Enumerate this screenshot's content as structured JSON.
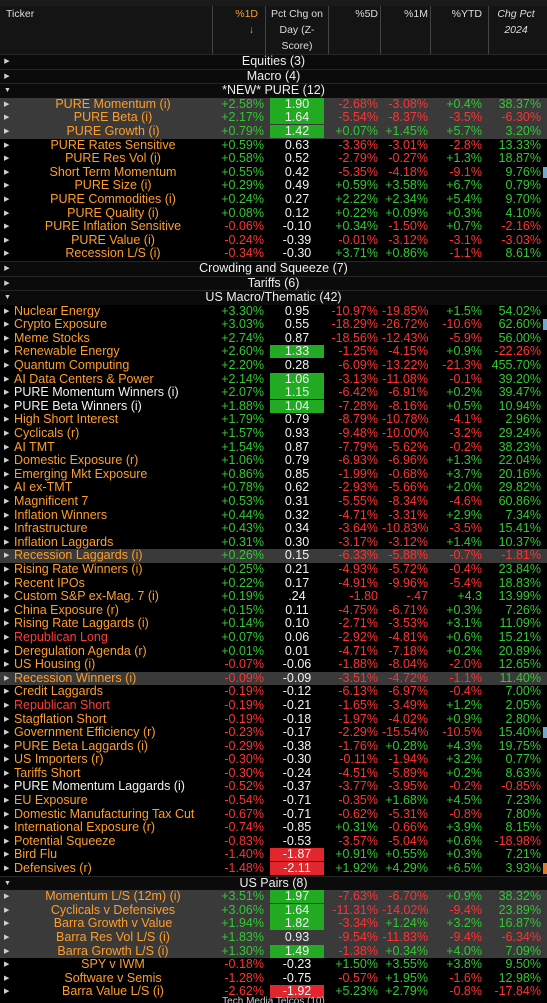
{
  "header": {
    "ticker": "Ticker",
    "pct_1d": "%1D",
    "z_score": "Pct Chg on Day (Z-Score)",
    "pct_5d": "%5D",
    "pct_1m": "%1M",
    "pct_ytd": "%YTD",
    "chg_2024": "Chg Pct 2024",
    "sort_icon": "arrow-down"
  },
  "colors": {
    "positive": "#32c832",
    "negative": "#ff3333",
    "z_positive_bg": "#22aa22",
    "z_negative_bg": "#e2262e",
    "orange": "#ff9d2a",
    "selected_row": "#3a3a3a"
  },
  "rows": [
    {
      "type": "group",
      "label": "Equities (3)",
      "expanded": false
    },
    {
      "type": "group",
      "label": "Macro (4)",
      "expanded": false
    },
    {
      "type": "group",
      "label": "*NEW* PURE (12)",
      "expanded": true
    },
    {
      "type": "row",
      "name": "PURE Momentum (i)",
      "style": "orange-center",
      "sel": true,
      "d1": "+2.58%",
      "z": "1.90",
      "zbg": "pos",
      "d5": "-2.68%",
      "m1": "-3.08%",
      "ytd": "+0.4%",
      "c24": "38.37%"
    },
    {
      "type": "row",
      "name": "PURE Beta (i)",
      "style": "orange-center",
      "sel": true,
      "d1": "+2.17%",
      "z": "1.64",
      "zbg": "pos",
      "d5": "-5.54%",
      "m1": "-8.37%",
      "ytd": "-3.5%",
      "c24": "-6.30%"
    },
    {
      "type": "row",
      "name": "PURE Growth (i)",
      "style": "orange-center",
      "sel": true,
      "d1": "+0.79%",
      "z": "1.42",
      "zbg": "pos",
      "d5": "+0.07%",
      "m1": "+1.45%",
      "ytd": "+5.7%",
      "c24": "3.20%"
    },
    {
      "type": "row",
      "name": "PURE Rates Sensitive",
      "style": "orange-center",
      "d1": "+0.59%",
      "z": "0.63",
      "d5": "-3.36%",
      "m1": "-3.01%",
      "ytd": "-2.8%",
      "c24": "13.33%"
    },
    {
      "type": "row",
      "name": "PURE Res Vol (i)",
      "style": "orange-center",
      "d1": "+0.58%",
      "z": "0.52",
      "d5": "-2.79%",
      "m1": "-0.27%",
      "ytd": "+1.3%",
      "c24": "18.87%"
    },
    {
      "type": "row",
      "name": "Short Term Momentum",
      "style": "orange-center",
      "d1": "+0.55%",
      "z": "0.42",
      "d5": "-5.35%",
      "m1": "-4.18%",
      "ytd": "-9.1%",
      "c24": "9.76%",
      "mark": true
    },
    {
      "type": "row",
      "name": "PURE Size (i)",
      "style": "orange-center",
      "d1": "+0.29%",
      "z": "0.49",
      "d5": "+0.59%",
      "m1": "+3.58%",
      "ytd": "+6.7%",
      "c24": "0.79%"
    },
    {
      "type": "row",
      "name": "PURE Commodities (i)",
      "style": "orange-center",
      "d1": "+0.24%",
      "z": "0.27",
      "d5": "+2.22%",
      "m1": "+2.34%",
      "ytd": "+5.4%",
      "c24": "9.70%"
    },
    {
      "type": "row",
      "name": "PURE Quality (i)",
      "style": "orange-center",
      "d1": "+0.08%",
      "z": "0.12",
      "d5": "+0.22%",
      "m1": "+0.09%",
      "ytd": "+0.3%",
      "c24": "4.10%"
    },
    {
      "type": "row",
      "name": "PURE Inflation Sensitive",
      "style": "orange-center",
      "d1": "-0.06%",
      "z": "-0.10",
      "d5": "+0.34%",
      "m1": "-1.50%",
      "ytd": "+0.7%",
      "c24": "-2.16%"
    },
    {
      "type": "row",
      "name": "PURE Value (i)",
      "style": "orange-center",
      "d1": "-0.24%",
      "z": "-0.39",
      "d5": "-0.01%",
      "m1": "-3.12%",
      "ytd": "-3.1%",
      "c24": "-3.03%"
    },
    {
      "type": "row",
      "name": "Recession L/S (i)",
      "style": "orange-center",
      "d1": "-0.34%",
      "z": "-0.30",
      "d5": "+3.71%",
      "m1": "+0.86%",
      "ytd": "-1.1%",
      "c24": "8.61%"
    },
    {
      "type": "group",
      "label": "Crowding and Squeeze (7)",
      "expanded": false
    },
    {
      "type": "group",
      "label": "Tariffs (6)",
      "expanded": false
    },
    {
      "type": "group",
      "label": "US Macro/Thematic (42)",
      "expanded": true
    },
    {
      "type": "row",
      "name": "Nuclear Energy",
      "style": "orange",
      "d1": "+3.30%",
      "z": "0.95",
      "d5": "-10.97%",
      "m1": "-19.85%",
      "ytd": "+1.5%",
      "c24": "54.02%"
    },
    {
      "type": "row",
      "name": "Crypto Exposure",
      "style": "orange",
      "d1": "+3.03%",
      "z": "0.55",
      "d5": "-18.29%",
      "m1": "-26.72%",
      "ytd": "-10.6%",
      "c24": "62.60%",
      "mark": true
    },
    {
      "type": "row",
      "name": "Meme Stocks",
      "style": "orange",
      "d1": "+2.74%",
      "z": "0.87",
      "d5": "-18.56%",
      "m1": "-12.43%",
      "ytd": "-5.9%",
      "c24": "56.00%"
    },
    {
      "type": "row",
      "name": "Renewable Energy",
      "style": "orange",
      "d1": "+2.60%",
      "z": "1.33",
      "zbg": "pos",
      "d5": "-1.25%",
      "m1": "-4.15%",
      "ytd": "+0.9%",
      "c24": "-22.26%"
    },
    {
      "type": "row",
      "name": "Quantum Computing",
      "style": "orange",
      "d1": "+2.20%",
      "z": "0.28",
      "d5": "-6.09%",
      "m1": "-13.22%",
      "ytd": "-21.3%",
      "c24": "455.70%"
    },
    {
      "type": "row",
      "name": "AI Data Centers & Power",
      "style": "orange",
      "d1": "+2.14%",
      "z": "1.06",
      "zbg": "pos",
      "d5": "-3.13%",
      "m1": "-11.08%",
      "ytd": "-0.1%",
      "c24": "39.20%"
    },
    {
      "type": "row",
      "name": "PURE Momentum Winners (i)",
      "style": "white",
      "d1": "+2.07%",
      "z": "1.15",
      "zbg": "pos",
      "d5": "-6.42%",
      "m1": "-6.91%",
      "ytd": "+0.2%",
      "c24": "39.47%"
    },
    {
      "type": "row",
      "name": "PURE Beta Winners (i)",
      "style": "white",
      "d1": "+1.88%",
      "z": "1.04",
      "zbg": "pos",
      "d5": "-7.28%",
      "m1": "-8.16%",
      "ytd": "+0.5%",
      "c24": "10.94%"
    },
    {
      "type": "row",
      "name": "High Short Interest",
      "style": "orange",
      "d1": "+1.79%",
      "z": "0.79",
      "d5": "-8.79%",
      "m1": "-10.78%",
      "ytd": "-4.1%",
      "c24": "2.96%"
    },
    {
      "type": "row",
      "name": "Cyclicals (r)",
      "style": "orange",
      "d1": "+1.57%",
      "z": "0.93",
      "d5": "-9.48%",
      "m1": "-10.00%",
      "ytd": "-3.2%",
      "c24": "29.24%"
    },
    {
      "type": "row",
      "name": "AI TMT",
      "style": "orange",
      "d1": "+1.54%",
      "z": "0.87",
      "d5": "-7.79%",
      "m1": "-5.62%",
      "ytd": "-0.2%",
      "c24": "38.23%"
    },
    {
      "type": "row",
      "name": "Domestic Exposure (r)",
      "style": "orange",
      "d1": "+1.06%",
      "z": "0.79",
      "d5": "-6.93%",
      "m1": "-6.96%",
      "ytd": "+1.3%",
      "c24": "22.04%"
    },
    {
      "type": "row",
      "name": "Emerging Mkt Exposure",
      "style": "orange",
      "d1": "+0.86%",
      "z": "0.85",
      "d5": "-1.99%",
      "m1": "-0.68%",
      "ytd": "+3.7%",
      "c24": "20.16%"
    },
    {
      "type": "row",
      "name": "AI ex-TMT",
      "style": "orange",
      "d1": "+0.78%",
      "z": "0.62",
      "d5": "-2.93%",
      "m1": "-5.66%",
      "ytd": "+2.0%",
      "c24": "29.82%"
    },
    {
      "type": "row",
      "name": "Magnificent 7",
      "style": "orange",
      "d1": "+0.53%",
      "z": "0.31",
      "d5": "-5.55%",
      "m1": "-8.34%",
      "ytd": "-4.6%",
      "c24": "60.86%"
    },
    {
      "type": "row",
      "name": "Inflation Winners",
      "style": "orange",
      "d1": "+0.44%",
      "z": "0.32",
      "d5": "-4.71%",
      "m1": "-3.31%",
      "ytd": "+2.9%",
      "c24": "7.34%"
    },
    {
      "type": "row",
      "name": "Infrastructure",
      "style": "orange",
      "d1": "+0.43%",
      "z": "0.34",
      "d5": "-3.64%",
      "m1": "-10.83%",
      "ytd": "-3.5%",
      "c24": "15.41%"
    },
    {
      "type": "row",
      "name": "Inflation Laggards",
      "style": "orange",
      "d1": "+0.31%",
      "z": "0.30",
      "d5": "-3.17%",
      "m1": "-3.12%",
      "ytd": "+1.4%",
      "c24": "10.37%"
    },
    {
      "type": "row",
      "name": "Recession Laggards (i)",
      "style": "orange",
      "sel": true,
      "d1": "+0.26%",
      "z": "0.15",
      "d5": "-6.33%",
      "m1": "-5.88%",
      "ytd": "-0.7%",
      "c24": "-1.81%"
    },
    {
      "type": "row",
      "name": "Rising Rate Winners (i)",
      "style": "orange",
      "d1": "+0.25%",
      "z": "0.21",
      "d5": "-4.93%",
      "m1": "-5.72%",
      "ytd": "-0.4%",
      "c24": "23.84%"
    },
    {
      "type": "row",
      "name": "Recent IPOs",
      "style": "orange",
      "d1": "+0.22%",
      "z": "0.17",
      "d5": "-4.91%",
      "m1": "-9.96%",
      "ytd": "-5.4%",
      "c24": "18.83%"
    },
    {
      "type": "row",
      "name": "Custom S&P ex-Mag. 7 (i)",
      "style": "orange",
      "d1": "+0.19%",
      "z": ".24",
      "d5": "-1.80",
      "m1": "-.47",
      "ytd": "+4.3",
      "c24": "13.99%"
    },
    {
      "type": "row",
      "name": "China Exposure (r)",
      "style": "orange",
      "d1": "+0.15%",
      "z": "0.11",
      "d5": "-4.75%",
      "m1": "-6.71%",
      "ytd": "+0.3%",
      "c24": "7.26%"
    },
    {
      "type": "row",
      "name": "Rising Rate Laggards (i)",
      "style": "orange",
      "d1": "+0.14%",
      "z": "0.10",
      "d5": "-2.71%",
      "m1": "-3.53%",
      "ytd": "+3.1%",
      "c24": "11.09%"
    },
    {
      "type": "row",
      "name": "Republican Long",
      "style": "red",
      "d1": "+0.07%",
      "z": "0.06",
      "d5": "-2.92%",
      "m1": "-4.81%",
      "ytd": "+0.6%",
      "c24": "15.21%"
    },
    {
      "type": "row",
      "name": "Deregulation Agenda (r)",
      "style": "orange",
      "d1": "+0.01%",
      "z": "0.01",
      "d5": "-4.71%",
      "m1": "-7.18%",
      "ytd": "+0.2%",
      "c24": "20.89%"
    },
    {
      "type": "row",
      "name": "US Housing (i)",
      "style": "orange",
      "d1": "-0.07%",
      "z": "-0.06",
      "d5": "-1.88%",
      "m1": "-8.04%",
      "ytd": "-2.0%",
      "c24": "12.65%"
    },
    {
      "type": "row",
      "name": "Recession Winners (i)",
      "style": "orange",
      "sel": true,
      "d1": "-0.09%",
      "z": "-0.09",
      "d5": "-3.51%",
      "m1": "-4.72%",
      "ytd": "-1.1%",
      "c24": "11.40%"
    },
    {
      "type": "row",
      "name": "Credit Laggards",
      "style": "orange",
      "d1": "-0.19%",
      "z": "-0.12",
      "d5": "-6.13%",
      "m1": "-6.97%",
      "ytd": "-0.4%",
      "c24": "7.00%"
    },
    {
      "type": "row",
      "name": "Republican Short",
      "style": "red",
      "d1": "-0.19%",
      "z": "-0.21",
      "d5": "-1.65%",
      "m1": "-3.49%",
      "ytd": "+1.2%",
      "c24": "2.05%"
    },
    {
      "type": "row",
      "name": "Stagflation Short",
      "style": "orange",
      "d1": "-0.19%",
      "z": "-0.18",
      "d5": "-1.97%",
      "m1": "-4.02%",
      "ytd": "+0.9%",
      "c24": "2.80%"
    },
    {
      "type": "row",
      "name": "Government Efficiency (r)",
      "style": "orange",
      "d1": "-0.23%",
      "z": "-0.17",
      "d5": "-2.29%",
      "m1": "-15.54%",
      "ytd": "-10.5%",
      "c24": "15.40%",
      "mark": true
    },
    {
      "type": "row",
      "name": "PURE Beta Laggards (i)",
      "style": "orange",
      "d1": "-0.29%",
      "z": "-0.38",
      "d5": "-1.76%",
      "m1": "+0.28%",
      "ytd": "+4.3%",
      "c24": "19.75%"
    },
    {
      "type": "row",
      "name": "US Importers (r)",
      "style": "orange",
      "d1": "-0.30%",
      "z": "-0.30",
      "d5": "-0.11%",
      "m1": "-1.94%",
      "ytd": "+3.2%",
      "c24": "0.77%"
    },
    {
      "type": "row",
      "name": "Tariffs Short",
      "style": "orange",
      "d1": "-0.30%",
      "z": "-0.24",
      "d5": "-4.51%",
      "m1": "-5.89%",
      "ytd": "+0.2%",
      "c24": "8.63%"
    },
    {
      "type": "row",
      "name": "PURE Momentum Laggards (i)",
      "style": "white",
      "d1": "-0.52%",
      "z": "-0.37",
      "d5": "-3.77%",
      "m1": "-3.95%",
      "ytd": "-0.2%",
      "c24": "-0.85%"
    },
    {
      "type": "row",
      "name": "EU Exposure",
      "style": "orange",
      "d1": "-0.54%",
      "z": "-0.71",
      "d5": "-0.35%",
      "m1": "+1.68%",
      "ytd": "+4.5%",
      "c24": "7.23%"
    },
    {
      "type": "row",
      "name": "Domestic Manufacturing Tax Cut",
      "style": "orange",
      "d1": "-0.67%",
      "z": "-0.71",
      "d5": "-0.62%",
      "m1": "-5.31%",
      "ytd": "-0.8%",
      "c24": "7.80%"
    },
    {
      "type": "row",
      "name": "International Exposure (r)",
      "style": "orange",
      "d1": "-0.74%",
      "z": "-0.85",
      "d5": "+0.31%",
      "m1": "-0.66%",
      "ytd": "+3.9%",
      "c24": "8.15%"
    },
    {
      "type": "row",
      "name": "Potential Squeeze",
      "style": "orange",
      "d1": "-0.83%",
      "z": "-0.53",
      "d5": "-3.57%",
      "m1": "-5.04%",
      "ytd": "+0.6%",
      "c24": "-18.98%"
    },
    {
      "type": "row",
      "name": "Bird Flu",
      "style": "orange",
      "d1": "-1.40%",
      "z": "-1.87",
      "zbg": "neg",
      "d5": "+0.91%",
      "m1": "+0.55%",
      "ytd": "+0.3%",
      "c24": "7.21%"
    },
    {
      "type": "row",
      "name": "Defensives (r)",
      "style": "orange",
      "d1": "-1.48%",
      "z": "-2.11",
      "zbg": "neg",
      "d5": "+1.92%",
      "m1": "+4.29%",
      "ytd": "+6.5%",
      "c24": "3.93%",
      "markO": true
    },
    {
      "type": "group",
      "label": "US Pairs (8)",
      "expanded": true
    },
    {
      "type": "row",
      "name": "Momentum L/S (12m) (i)",
      "style": "orange-center",
      "sel": true,
      "d1": "+3.51%",
      "z": "1.97",
      "zbg": "pos",
      "d5": "-7.63%",
      "m1": "-6.70%",
      "ytd": "+0.9%",
      "c24": "38.32%"
    },
    {
      "type": "row",
      "name": "Cyclicals v Defensives",
      "style": "orange-center",
      "sel": true,
      "d1": "+3.06%",
      "z": "1.64",
      "zbg": "pos",
      "d5": "-11.31%",
      "m1": "-14.02%",
      "ytd": "-9.4%",
      "c24": "23.89%"
    },
    {
      "type": "row",
      "name": "Barra Growth v Value",
      "style": "orange-center",
      "sel": true,
      "d1": "+1.94%",
      "z": "1.82",
      "zbg": "pos",
      "d5": "-3.34%",
      "m1": "+1.24%",
      "ytd": "+3.2%",
      "c24": "16.87%"
    },
    {
      "type": "row",
      "name": "Barra Res Vol L/S (i)",
      "style": "orange-center",
      "sel": true,
      "d1": "+1.83%",
      "z": "0.93",
      "d5": "-9.54%",
      "m1": "-11.83%",
      "ytd": "-9.4%",
      "c24": "-6.34%"
    },
    {
      "type": "row",
      "name": "Barra Growth L/S (i)",
      "style": "orange-center",
      "sel": true,
      "d1": "+1.30%",
      "z": "1.49",
      "zbg": "pos",
      "d5": "-1.38%",
      "m1": "+0.34%",
      "ytd": "+4.0%",
      "c24": "7.09%"
    },
    {
      "type": "row",
      "name": "SPY v IWM",
      "style": "orange-center",
      "d1": "-0.18%",
      "z": "-0.23",
      "d5": "+1.50%",
      "m1": "+3.55%",
      "ytd": "+3.8%",
      "c24": "9.50%"
    },
    {
      "type": "row",
      "name": "Software v Semis",
      "style": "orange-center",
      "d1": "-1.28%",
      "z": "-0.75",
      "d5": "-0.57%",
      "m1": "+1.95%",
      "ytd": "-1.6%",
      "c24": "12.98%"
    },
    {
      "type": "row",
      "name": "Barra Value L/S (i)",
      "style": "orange-center",
      "d1": "-2.62%",
      "z": "-1.92",
      "zbg": "neg",
      "d5": "+5.23%",
      "m1": "+2.79%",
      "ytd": "-0.8%",
      "c24": "-17.84%"
    }
  ],
  "footer_label": "Tech Media Telcos (10)"
}
